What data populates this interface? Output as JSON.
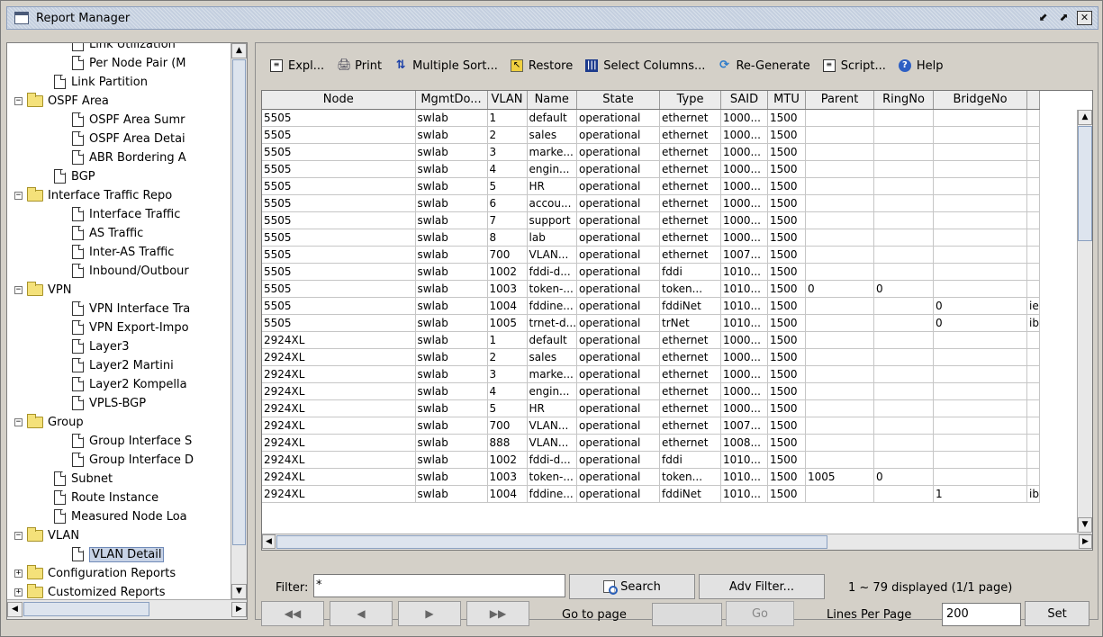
{
  "window": {
    "title": "Report Manager",
    "controls": [
      "restore-icon",
      "maximize-icon",
      "close-icon"
    ]
  },
  "tree": [
    {
      "label": "Link Utilization",
      "level": 3,
      "type": "doc",
      "partial": true
    },
    {
      "label": "Per Node Pair (M",
      "level": 3,
      "type": "doc"
    },
    {
      "label": "Link Partition",
      "level": 2,
      "type": "doc"
    },
    {
      "label": "OSPF Area",
      "level": 1,
      "type": "folder",
      "expander": "−"
    },
    {
      "label": "OSPF Area Sumr",
      "level": 3,
      "type": "doc"
    },
    {
      "label": "OSPF Area Detai",
      "level": 3,
      "type": "doc"
    },
    {
      "label": "ABR Bordering A",
      "level": 3,
      "type": "doc"
    },
    {
      "label": "BGP",
      "level": 2,
      "type": "doc"
    },
    {
      "label": "Interface Traffic Repo",
      "level": 1,
      "type": "folder",
      "expander": "−"
    },
    {
      "label": "Interface Traffic",
      "level": 3,
      "type": "doc"
    },
    {
      "label": "AS Traffic",
      "level": 3,
      "type": "doc"
    },
    {
      "label": "Inter-AS Traffic",
      "level": 3,
      "type": "doc"
    },
    {
      "label": "Inbound/Outbour",
      "level": 3,
      "type": "doc"
    },
    {
      "label": "VPN",
      "level": 1,
      "type": "folder",
      "expander": "−"
    },
    {
      "label": "VPN Interface Tra",
      "level": 3,
      "type": "doc"
    },
    {
      "label": "VPN Export-Impo",
      "level": 3,
      "type": "doc"
    },
    {
      "label": "Layer3",
      "level": 3,
      "type": "doc"
    },
    {
      "label": "Layer2 Martini",
      "level": 3,
      "type": "doc"
    },
    {
      "label": "Layer2 Kompella",
      "level": 3,
      "type": "doc"
    },
    {
      "label": "VPLS-BGP",
      "level": 3,
      "type": "doc"
    },
    {
      "label": "Group",
      "level": 1,
      "type": "folder",
      "expander": "−"
    },
    {
      "label": "Group Interface S",
      "level": 3,
      "type": "doc"
    },
    {
      "label": "Group Interface D",
      "level": 3,
      "type": "doc"
    },
    {
      "label": "Subnet",
      "level": 2,
      "type": "doc"
    },
    {
      "label": "Route Instance",
      "level": 2,
      "type": "doc"
    },
    {
      "label": "Measured Node Loa",
      "level": 2,
      "type": "doc"
    },
    {
      "label": "VLAN",
      "level": 1,
      "type": "folder",
      "expander": "−"
    },
    {
      "label": "VLAN Detail",
      "level": 3,
      "type": "doc",
      "selected": true
    },
    {
      "label": "Configuration Reports",
      "level": 0,
      "type": "folder",
      "expander": "+"
    },
    {
      "label": "Customized Reports",
      "level": 0,
      "type": "folder",
      "expander": "+"
    }
  ],
  "toolbar": [
    {
      "label": "Expl...",
      "icon": "document-icon",
      "cls": "ic-doc",
      "glyph": "≡"
    },
    {
      "label": "Print",
      "icon": "printer-icon",
      "cls": "ic-print",
      "glyph": "🖨"
    },
    {
      "label": "Multiple Sort...",
      "icon": "sort-icon",
      "cls": "ic-sort",
      "glyph": "⇅"
    },
    {
      "label": "Restore",
      "icon": "restore-icon",
      "cls": "ic-restore",
      "glyph": "↖"
    },
    {
      "label": "Select Columns...",
      "icon": "columns-icon",
      "cls": "ic-cols",
      "glyph": "|||"
    },
    {
      "label": "Re-Generate",
      "icon": "regenerate-icon",
      "cls": "ic-regen",
      "glyph": "⟳"
    },
    {
      "label": "Script...",
      "icon": "script-icon",
      "cls": "ic-doc",
      "glyph": "≡"
    },
    {
      "label": "Help",
      "icon": "help-icon",
      "cls": "ic-help",
      "glyph": "?"
    }
  ],
  "table": {
    "columns": [
      "Node",
      "MgmtDo...",
      "VLAN",
      "Name",
      "State",
      "Type",
      "SAID",
      "MTU",
      "Parent",
      "RingNo",
      "BridgeNo",
      ""
    ],
    "rows": [
      [
        "5505",
        "swlab",
        "1",
        "default",
        "operational",
        "ethernet",
        "1000...",
        "1500",
        "",
        "",
        "",
        ""
      ],
      [
        "5505",
        "swlab",
        "2",
        "sales",
        "operational",
        "ethernet",
        "1000...",
        "1500",
        "",
        "",
        "",
        ""
      ],
      [
        "5505",
        "swlab",
        "3",
        "marke...",
        "operational",
        "ethernet",
        "1000...",
        "1500",
        "",
        "",
        "",
        ""
      ],
      [
        "5505",
        "swlab",
        "4",
        "engin...",
        "operational",
        "ethernet",
        "1000...",
        "1500",
        "",
        "",
        "",
        ""
      ],
      [
        "5505",
        "swlab",
        "5",
        "HR",
        "operational",
        "ethernet",
        "1000...",
        "1500",
        "",
        "",
        "",
        ""
      ],
      [
        "5505",
        "swlab",
        "6",
        "accou...",
        "operational",
        "ethernet",
        "1000...",
        "1500",
        "",
        "",
        "",
        ""
      ],
      [
        "5505",
        "swlab",
        "7",
        "support",
        "operational",
        "ethernet",
        "1000...",
        "1500",
        "",
        "",
        "",
        ""
      ],
      [
        "5505",
        "swlab",
        "8",
        "lab",
        "operational",
        "ethernet",
        "1000...",
        "1500",
        "",
        "",
        "",
        ""
      ],
      [
        "5505",
        "swlab",
        "700",
        "VLAN...",
        "operational",
        "ethernet",
        "1007...",
        "1500",
        "",
        "",
        "",
        ""
      ],
      [
        "5505",
        "swlab",
        "1002",
        "fddi-d...",
        "operational",
        "fddi",
        "1010...",
        "1500",
        "",
        "",
        "",
        ""
      ],
      [
        "5505",
        "swlab",
        "1003",
        "token-...",
        "operational",
        "token...",
        "1010...",
        "1500",
        "0",
        "0",
        "",
        ""
      ],
      [
        "5505",
        "swlab",
        "1004",
        "fddine...",
        "operational",
        "fddiNet",
        "1010...",
        "1500",
        "",
        "",
        "0",
        "ie"
      ],
      [
        "5505",
        "swlab",
        "1005",
        "trnet-d...",
        "operational",
        "trNet",
        "1010...",
        "1500",
        "",
        "",
        "0",
        "ib"
      ],
      [
        "2924XL",
        "swlab",
        "1",
        "default",
        "operational",
        "ethernet",
        "1000...",
        "1500",
        "",
        "",
        "",
        ""
      ],
      [
        "2924XL",
        "swlab",
        "2",
        "sales",
        "operational",
        "ethernet",
        "1000...",
        "1500",
        "",
        "",
        "",
        ""
      ],
      [
        "2924XL",
        "swlab",
        "3",
        "marke...",
        "operational",
        "ethernet",
        "1000...",
        "1500",
        "",
        "",
        "",
        ""
      ],
      [
        "2924XL",
        "swlab",
        "4",
        "engin...",
        "operational",
        "ethernet",
        "1000...",
        "1500",
        "",
        "",
        "",
        ""
      ],
      [
        "2924XL",
        "swlab",
        "5",
        "HR",
        "operational",
        "ethernet",
        "1000...",
        "1500",
        "",
        "",
        "",
        ""
      ],
      [
        "2924XL",
        "swlab",
        "700",
        "VLAN...",
        "operational",
        "ethernet",
        "1007...",
        "1500",
        "",
        "",
        "",
        ""
      ],
      [
        "2924XL",
        "swlab",
        "888",
        "VLAN...",
        "operational",
        "ethernet",
        "1008...",
        "1500",
        "",
        "",
        "",
        ""
      ],
      [
        "2924XL",
        "swlab",
        "1002",
        "fddi-d...",
        "operational",
        "fddi",
        "1010...",
        "1500",
        "",
        "",
        "",
        ""
      ],
      [
        "2924XL",
        "swlab",
        "1003",
        "token-...",
        "operational",
        "token...",
        "1010...",
        "1500",
        "1005",
        "0",
        "",
        ""
      ],
      [
        "2924XL",
        "swlab",
        "1004",
        "fddine...",
        "operational",
        "fddiNet",
        "1010...",
        "1500",
        "",
        "",
        "1",
        "ib"
      ]
    ]
  },
  "filter": {
    "label": "Filter:",
    "value": "*"
  },
  "search_label": "Search",
  "adv_filter_label": "Adv Filter...",
  "count_text": "1 ~ 79 displayed (1/1 page)",
  "nav": {
    "first": "◀◀",
    "prev": "◀",
    "next": "▶",
    "last": "▶▶"
  },
  "goto_label": "Go to page",
  "go_label": "Go",
  "lines_label": "Lines Per Page",
  "lines_value": "200",
  "set_label": "Set"
}
